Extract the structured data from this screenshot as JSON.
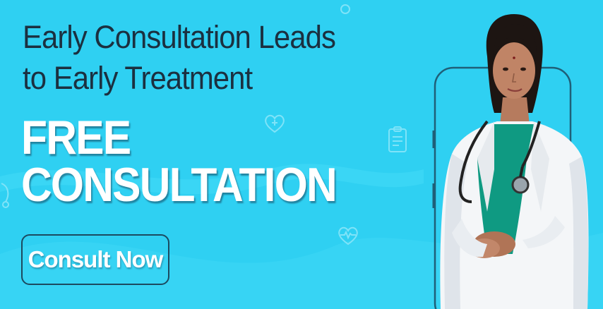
{
  "banner": {
    "headline_line1": "Early Consultation Leads",
    "headline_line2": "to Early Treatment",
    "offer_line1": "FREE",
    "offer_line2": "CONSULTATION",
    "cta_label": "Consult Now"
  },
  "colors": {
    "background": "#2fd0f2",
    "headline_text": "#1b3040",
    "offer_text": "#ffffff",
    "cta_border": "#1c4a60"
  },
  "illustration": {
    "main_image": "doctor-photo",
    "frame": "phone-outline-icon",
    "background_icons": [
      "heart-icon",
      "clipboard-icon",
      "heartbeat-icon",
      "stethoscope-icon"
    ]
  }
}
